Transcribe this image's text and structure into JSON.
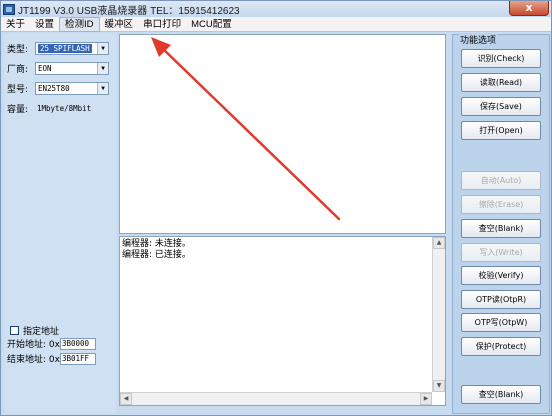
{
  "window": {
    "title": "JT1199 V3.0 USB液晶烧录器   TEL：15915412623",
    "close_label": "x"
  },
  "menu": [
    {
      "label": "关于",
      "active": false
    },
    {
      "label": "设置",
      "active": false
    },
    {
      "label": "检测ID",
      "active": true
    },
    {
      "label": "缓冲区",
      "active": false
    },
    {
      "label": "串口打印",
      "active": false
    },
    {
      "label": "MCU配置",
      "active": false
    }
  ],
  "left": {
    "type_label": "类型:",
    "type_value": "25 SPIFLASH",
    "vendor_label": "厂商:",
    "vendor_value": "EON",
    "model_label": "型号:",
    "model_value": "EN25T80",
    "capacity_label": "容量:",
    "capacity_value": "1Mbyte/8Mbit",
    "specify_address_label": "指定地址",
    "start_address_label": "开始地址: 0x",
    "start_address_value": "3B0000",
    "end_address_label": "结束地址: 0x",
    "end_address_value": "3B01FF"
  },
  "log": {
    "lines": [
      "编程器: 未连接。",
      "编程器: 已连接。"
    ]
  },
  "right": {
    "group_title": "功能选项",
    "buttons": [
      {
        "label": "识别(Check)",
        "enabled": true
      },
      {
        "label": "读取(Read)",
        "enabled": true
      },
      {
        "label": "保存(Save)",
        "enabled": true
      },
      {
        "label": "打开(Open)",
        "enabled": true
      },
      {
        "label": "自动(Auto)",
        "enabled": false
      },
      {
        "label": "擦除(Erase)",
        "enabled": false
      },
      {
        "label": "查空(Blank)",
        "enabled": true
      },
      {
        "label": "写入(Write)",
        "enabled": false
      },
      {
        "label": "校验(Verify)",
        "enabled": true
      },
      {
        "label": "OTP读(OtpR)",
        "enabled": true
      },
      {
        "label": "OTP写(OtpW)",
        "enabled": true
      },
      {
        "label": "保护(Protect)",
        "enabled": true
      },
      {
        "label": "查空(Blank)",
        "enabled": true
      }
    ]
  },
  "colors": {
    "annotation_arrow": "#e03a2e",
    "panel_bg": "#cfe0f2",
    "selection": "#3565b5"
  }
}
